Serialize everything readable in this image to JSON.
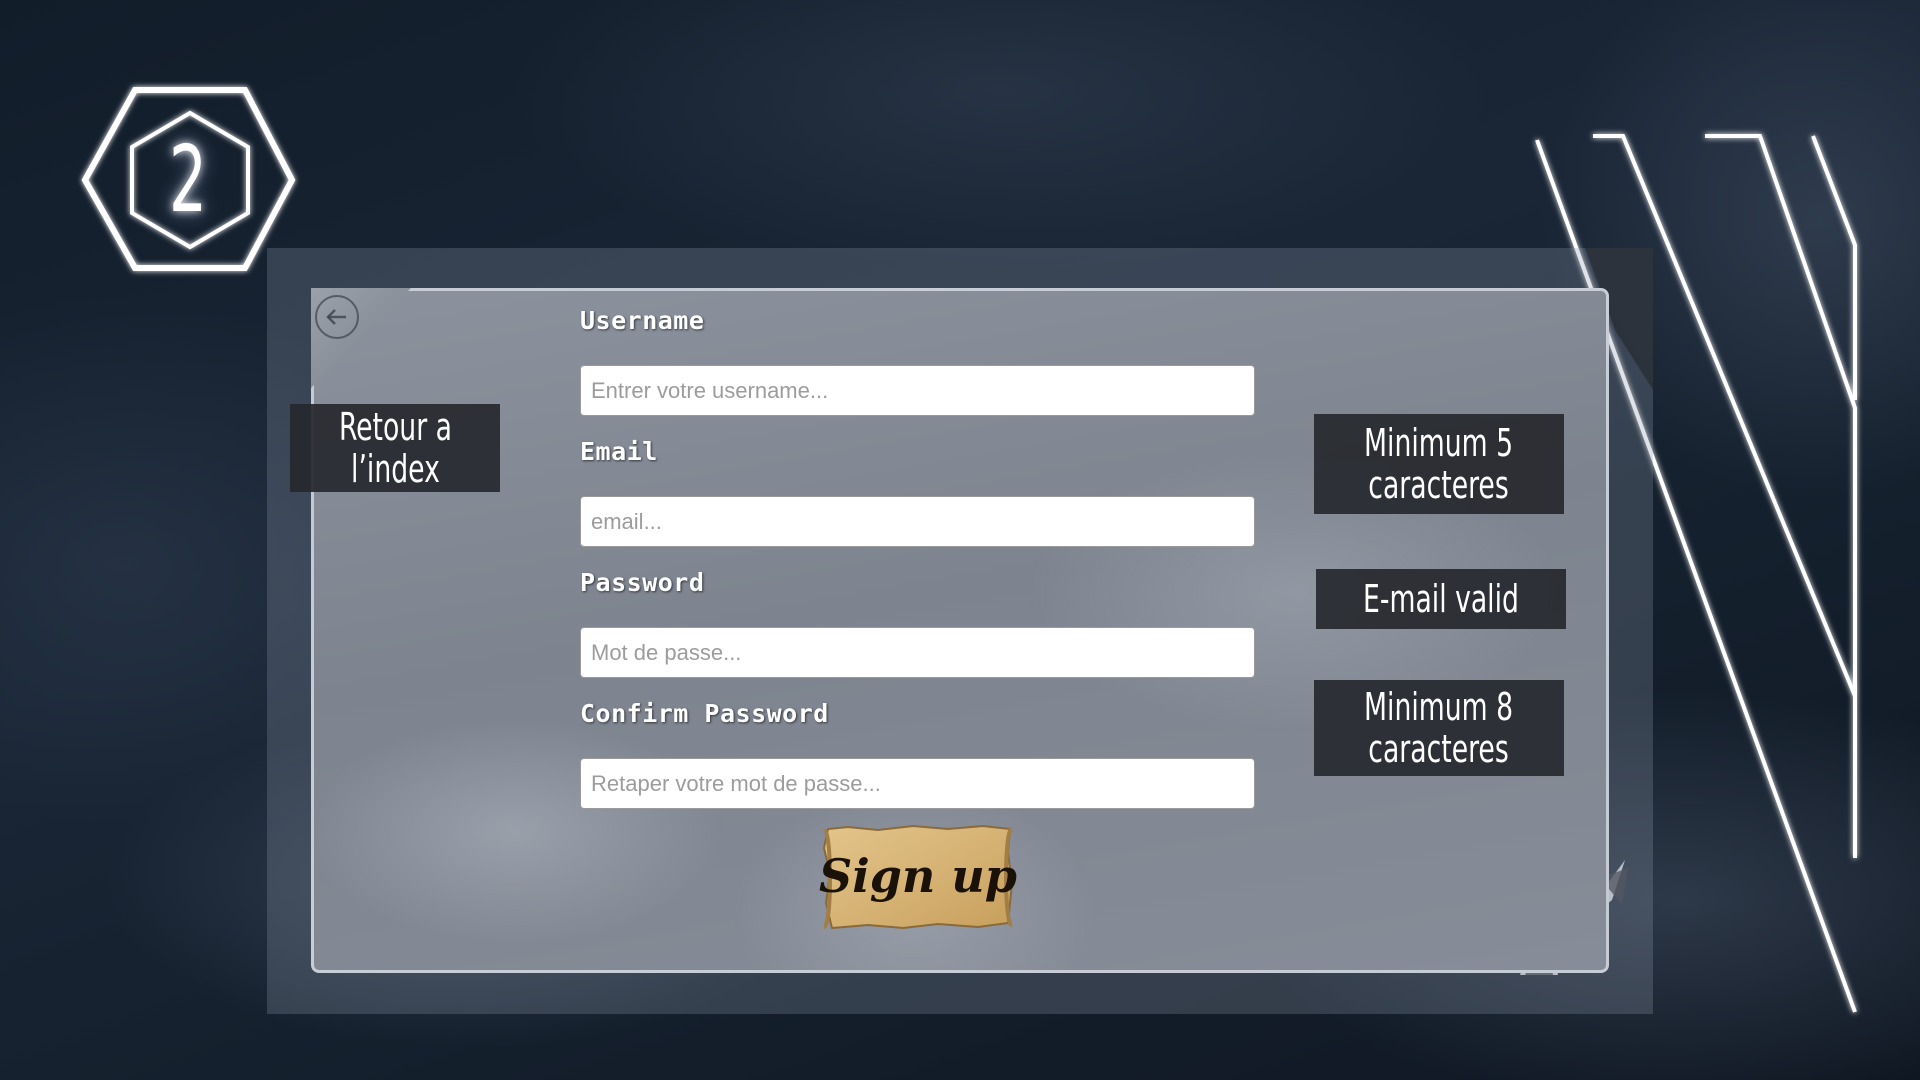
{
  "step": {
    "number": "2"
  },
  "back": {
    "callout": "Retour a\nl’index"
  },
  "form": {
    "username": {
      "label": "Username",
      "placeholder": "Entrer votre username...",
      "hint": "Minimum 5\ncaracteres"
    },
    "email": {
      "label": "Email",
      "placeholder": "email...",
      "hint": "E-mail valid"
    },
    "password": {
      "label": "Password",
      "placeholder": "Mot de passe...",
      "hint": "Minimum 8\ncaracteres"
    },
    "confirm_password": {
      "label": "Confirm Password",
      "placeholder": "Retaper votre mot de passe..."
    },
    "submit_label": "Sign up"
  },
  "colors": {
    "background": "#16212e",
    "panel": "#80868f",
    "callout_bg": "#26282e",
    "parchment": "#d8b77c",
    "glow": "#ffffff"
  },
  "icons": {
    "back": "arrow-left-circle-icon",
    "step_badge": "hexagon-icon"
  }
}
